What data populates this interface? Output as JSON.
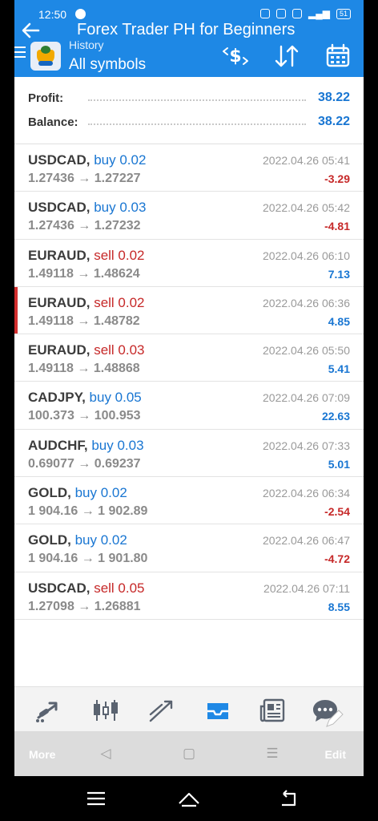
{
  "status_bar": {
    "time": "12:50",
    "battery": "51"
  },
  "overlay_title": "Forex Trader PH for Beginners",
  "header": {
    "subtitle": "History",
    "title": "All symbols"
  },
  "summary": [
    {
      "label": "Profit:",
      "value": "38.22"
    },
    {
      "label": "Balance:",
      "value": "38.22"
    }
  ],
  "deals": [
    {
      "symbol": "USDCAD,",
      "type": "buy 0.02",
      "side": "buy",
      "prices": "1.27436 → 1.27227",
      "time": "2022.04.26 05:41",
      "profit": "-3.29",
      "profit_sign": "neg"
    },
    {
      "symbol": "USDCAD,",
      "type": "buy 0.03",
      "side": "buy",
      "prices": "1.27436 → 1.27232",
      "time": "2022.04.26 05:42",
      "profit": "-4.81",
      "profit_sign": "neg"
    },
    {
      "symbol": "EURAUD,",
      "type": "sell 0.02",
      "side": "sell",
      "prices": "1.49118 → 1.48624",
      "time": "2022.04.26 06:10",
      "profit": "7.13",
      "profit_sign": "pos"
    },
    {
      "symbol": "EURAUD,",
      "type": "sell 0.02",
      "side": "sell",
      "prices": "1.49118 → 1.48782",
      "time": "2022.04.26 06:36",
      "profit": "4.85",
      "profit_sign": "pos",
      "selected": true
    },
    {
      "symbol": "EURAUD,",
      "type": "sell 0.03",
      "side": "sell",
      "prices": "1.49118 → 1.48868",
      "time": "2022.04.26 05:50",
      "profit": "5.41",
      "profit_sign": "pos"
    },
    {
      "symbol": "CADJPY,",
      "type": "buy 0.05",
      "side": "buy",
      "prices": "100.373 → 100.953",
      "time": "2022.04.26 07:09",
      "profit": "22.63",
      "profit_sign": "pos"
    },
    {
      "symbol": "AUDCHF,",
      "type": "buy 0.03",
      "side": "buy",
      "prices": "0.69077 → 0.69237",
      "time": "2022.04.26 07:33",
      "profit": "5.01",
      "profit_sign": "pos"
    },
    {
      "symbol": "GOLD,",
      "type": "buy 0.02",
      "side": "buy",
      "prices": "1 904.16 → 1 902.89",
      "time": "2022.04.26 06:34",
      "profit": "-2.54",
      "profit_sign": "neg"
    },
    {
      "symbol": "GOLD,",
      "type": "buy 0.02",
      "side": "buy",
      "prices": "1 904.16 → 1 901.80",
      "time": "2022.04.26 06:47",
      "profit": "-4.72",
      "profit_sign": "neg"
    },
    {
      "symbol": "USDCAD,",
      "type": "sell 0.05",
      "side": "sell",
      "prices": "1.27098 → 1.26881",
      "time": "2022.04.26 07:11",
      "profit": "8.55",
      "profit_sign": "pos"
    }
  ],
  "tabs": [
    {
      "name": "tab-quotes",
      "icon": "quotes-icon"
    },
    {
      "name": "tab-chart",
      "icon": "candlestick-icon"
    },
    {
      "name": "tab-trade",
      "icon": "trade-icon"
    },
    {
      "name": "tab-history",
      "icon": "inbox-icon",
      "active": true
    },
    {
      "name": "tab-news",
      "icon": "news-icon"
    },
    {
      "name": "tab-chat",
      "icon": "chat-icon"
    }
  ],
  "overlay_nav": {
    "more": "More",
    "edit": "Edit"
  },
  "colors": {
    "accent": "#1e88e5",
    "buy": "#1976d2",
    "sell": "#c62828",
    "selected_marker": "#d32f2f"
  }
}
